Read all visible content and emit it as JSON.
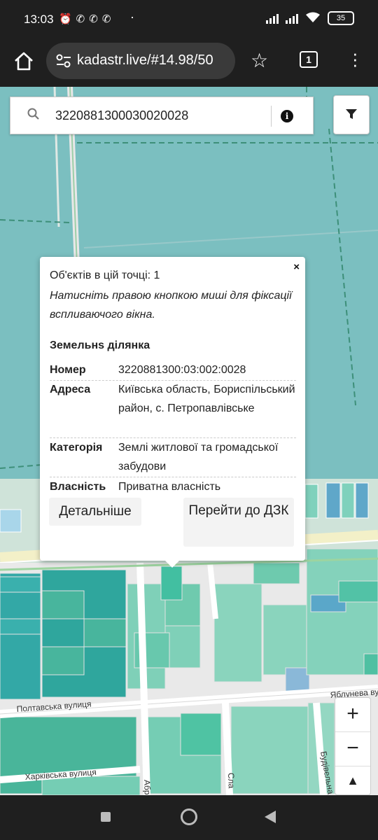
{
  "status_bar": {
    "time": "13:03",
    "battery": "35"
  },
  "browser": {
    "url": "kadastr.live/#14.98/50",
    "tab_count": "1"
  },
  "search": {
    "query": "3220881300030020028",
    "info_label": "i"
  },
  "popup": {
    "count_text": "Об'єктів в цій точці: 1",
    "hint_text": "Натисніть правою кнопкою миші для фіксації вспливаючого вікна.",
    "section_title": "Земельнs ділянка",
    "properties": [
      {
        "key": "Номер",
        "value": "3220881300:03:002:0028"
      },
      {
        "key": "Адреса",
        "value": "Київська область, Бориспільський район, с. Петропавлівське"
      },
      {
        "key": "Категорія",
        "value": "Землі житлової та громадської забудови"
      },
      {
        "key": "Власність",
        "value": "Приватна власність"
      }
    ],
    "details_button": "Детальніше",
    "dzk_button": "Перейти до ДЗК",
    "close_label": "×"
  },
  "map": {
    "street_labels": [
      "Полтавська вулиця",
      "Харківська вулиця",
      "Яблунева вули",
      "Будівельна ву",
      "Абр",
      "Сла"
    ]
  },
  "zoom": {
    "in_label": "+",
    "out_label": "−",
    "compass_label": "▲"
  }
}
